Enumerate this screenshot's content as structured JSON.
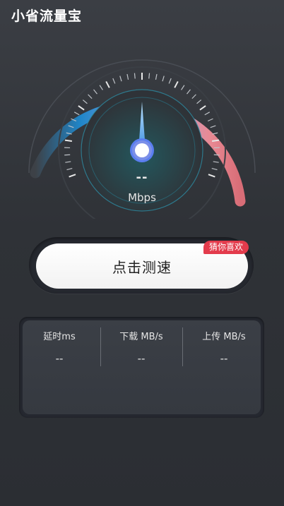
{
  "app": {
    "title": "小省流量宝"
  },
  "gauge": {
    "speed_value": "--",
    "unit": "Mbps",
    "needle_level": 0,
    "arc_gradient_colors": [
      "#1f86c9",
      "#9fa6e6",
      "#e98a94"
    ]
  },
  "start_button": {
    "label": "点击测速"
  },
  "badge": {
    "label": "猜你喜欢",
    "color": "#e33b4c"
  },
  "stats": [
    {
      "label": "延时ms",
      "value": "--"
    },
    {
      "label": "下载 MB/s",
      "value": "--"
    },
    {
      "label": "上传 MB/s",
      "value": "--"
    }
  ]
}
